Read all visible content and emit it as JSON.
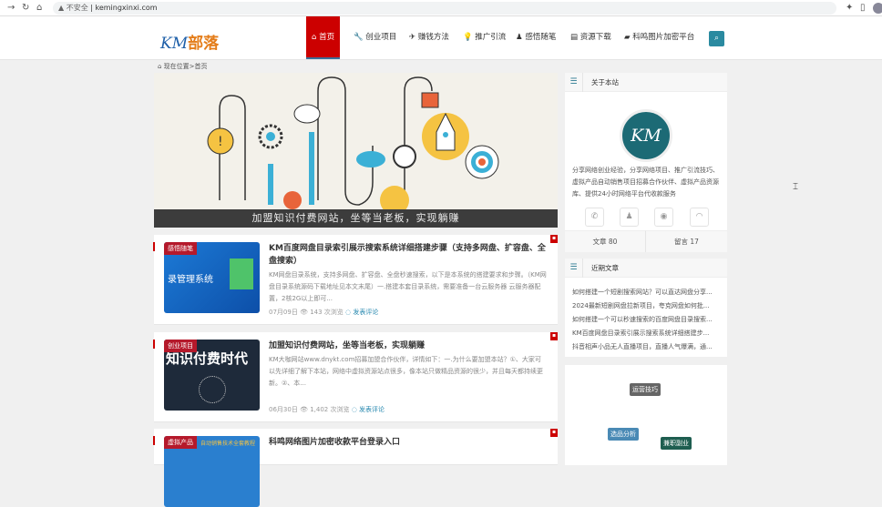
{
  "browser": {
    "url": "kemingxinxi.com",
    "security": "不安全"
  },
  "logo": {
    "km": "KM",
    "name": "部落"
  },
  "nav": [
    {
      "label": "首页",
      "icon": "home"
    },
    {
      "label": "创业项目",
      "icon": "wrench"
    },
    {
      "label": "赚钱方法",
      "icon": "twitter"
    },
    {
      "label": "推广引流",
      "icon": "bulb"
    },
    {
      "label": "感悟随笔",
      "icon": "user"
    },
    {
      "label": "资源下载",
      "icon": "comment"
    },
    {
      "label": "科鸣图片加密平台",
      "icon": "folder"
    }
  ],
  "breadcrumb": {
    "label": "现在位置",
    "sep": ">",
    "current": "首页"
  },
  "slider": {
    "caption": "加盟知识付费网站，坐等当老板，实现躺赚"
  },
  "posts": [
    {
      "category": "感悟随笔",
      "thumb_text": "录管理系统",
      "title": "KM百度网盘目录索引展示搜索系统详细搭建步骤（支持多网盘、扩容盘、全盘搜索）",
      "excerpt": "KM网盘目录系统，支持多网盘、扩容盘、全盘秒速搜索，以下是本系统的搭建要求和步骤。（KM网盘目录系统源码下载地址见本文末尾）一.搭建本套目录系统，需要准备一台云服务器 云服务器配置，2核2G以上即可...",
      "date": "07月09日",
      "views": "143 次浏览",
      "comment": "发表评论"
    },
    {
      "category": "创业项目",
      "thumb_text": "知识付费时代",
      "title": "加盟知识付费网站，坐等当老板，实现躺赚",
      "excerpt": "KM大咖网站www.dnykt.com招募加盟合作伙伴，详情如下：一.为什么要加盟本站？①、大家可以先详细了解下本站，网络中虚拟资源站点很多，像本站只做精品资源的很少，并且每天都持续更新。②、本...",
      "date": "06月30日",
      "views": "1,402 次浏览",
      "comment": "发表评论"
    },
    {
      "category": "虚拟产品",
      "thumb_text": "自动销售技术全套教程",
      "title": "科鸣网络图片加密收款平台登录入口"
    }
  ],
  "about": {
    "title": "关于本站",
    "avatar": "KM",
    "desc": "分享网络创业经验，分享网络项目、推广引流技巧、虚拟产品自动销售项目招募合作伙伴、虚拟产品资源库、提供24小时网络平台代收款服务",
    "articles": "文章 80",
    "comments": "留言 17"
  },
  "recent": {
    "title": "近期文章",
    "items": [
      "如何搭建一个短剧搜索网站？可以直达网盘分享...",
      "2024最新短剧网盘拉新项目，夸克网盘如何批...",
      "如何搭建一个可以秒速搜索的百度网盘目录搜索...",
      "KM百度网盘目录索引展示搜索系统详细搭建步...",
      "抖音相声小品无人直播项目，直播人气爆满，通..."
    ]
  },
  "tags": [
    {
      "label": "运营技巧",
      "color": "#666666"
    },
    {
      "label": "选品分析",
      "color": "#4a8ab5"
    },
    {
      "label": "兼职副业",
      "color": "#1e5e50"
    }
  ]
}
